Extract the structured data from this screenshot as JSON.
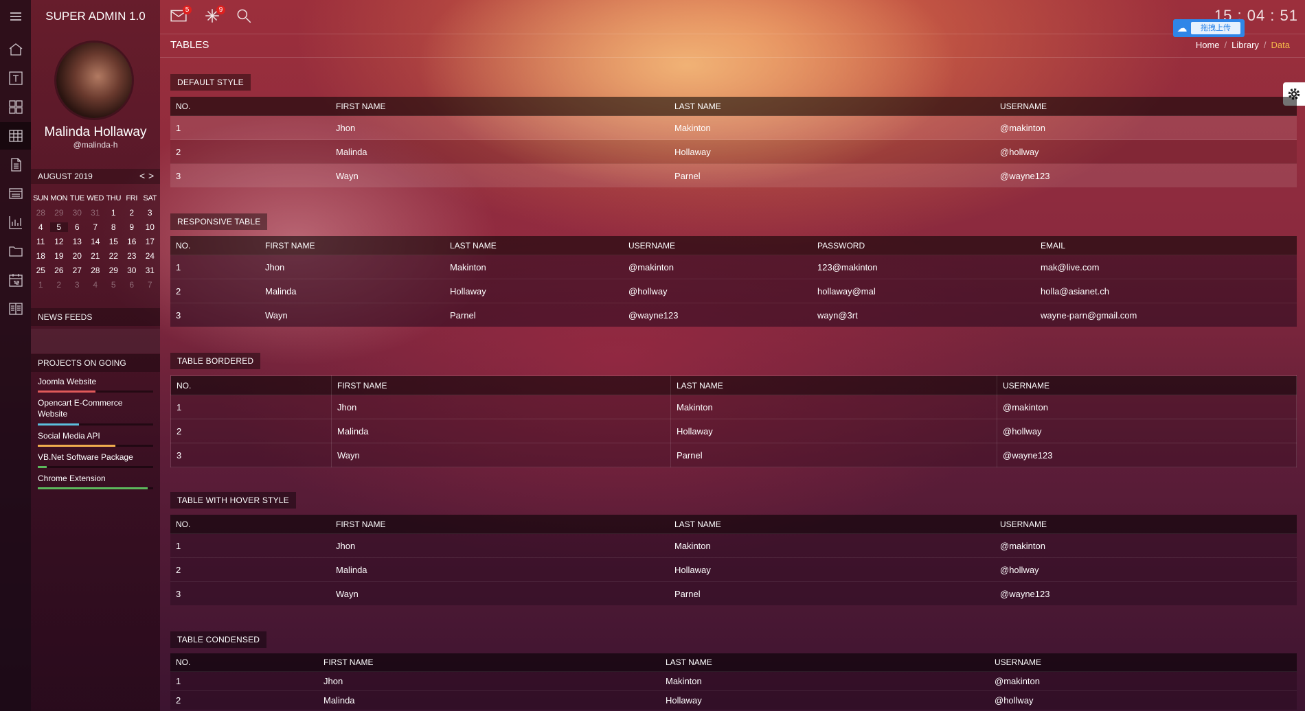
{
  "app": {
    "title": "SUPER ADMIN 1.0"
  },
  "topbar": {
    "mail_badge": "5",
    "notify_badge": "9",
    "clock": "15 : 04 : 51",
    "upload_label": "拖拽上传"
  },
  "page": {
    "title": "TABLES",
    "breadcrumb": [
      "Home",
      "Library",
      "Data"
    ]
  },
  "profile": {
    "name": "Malinda Hollaway",
    "handle": "@malinda-h"
  },
  "calendar": {
    "month": "AUGUST 2019",
    "prev": "<",
    "next": ">",
    "weekdays": [
      "SUN",
      "MON",
      "TUE",
      "WED",
      "THU",
      "FRI",
      "SAT"
    ],
    "weeks": [
      [
        "28",
        "29",
        "30",
        "31",
        "1",
        "2",
        "3"
      ],
      [
        "4",
        "5",
        "6",
        "7",
        "8",
        "9",
        "10"
      ],
      [
        "11",
        "12",
        "13",
        "14",
        "15",
        "16",
        "17"
      ],
      [
        "18",
        "19",
        "20",
        "21",
        "22",
        "23",
        "24"
      ],
      [
        "25",
        "26",
        "27",
        "28",
        "29",
        "30",
        "31"
      ],
      [
        "1",
        "2",
        "3",
        "4",
        "5",
        "6",
        "7"
      ]
    ]
  },
  "news": {
    "title": "NEWS FEEDS"
  },
  "projects": {
    "title": "PROJECTS ON GOING",
    "items": [
      {
        "name": "Joomla Website",
        "progress": 0.5,
        "color": "#e05a5a"
      },
      {
        "name": "Opencart E-Commerce Website",
        "progress": 0.36,
        "color": "#5bc0de"
      },
      {
        "name": "Social Media API",
        "progress": 0.67,
        "color": "#f0ad4e"
      },
      {
        "name": "VB.Net Software Package",
        "progress": 0.08,
        "color": "#5cb85c"
      },
      {
        "name": "Chrome Extension",
        "progress": 0.95,
        "color": "#5cb85c"
      }
    ]
  },
  "tables": {
    "default": {
      "label": "DEFAULT STYLE",
      "headers": [
        "NO.",
        "FIRST NAME",
        "LAST NAME",
        "USERNAME"
      ],
      "rows": [
        [
          "1",
          "Jhon",
          "Makinton",
          "@makinton"
        ],
        [
          "2",
          "Malinda",
          "Hollaway",
          "@hollway"
        ],
        [
          "3",
          "Wayn",
          "Parnel",
          "@wayne123"
        ]
      ]
    },
    "responsive": {
      "label": "RESPONSIVE TABLE",
      "headers": [
        "NO.",
        "FIRST NAME",
        "LAST NAME",
        "USERNAME",
        "PASSWORD",
        "EMAIL"
      ],
      "rows": [
        [
          "1",
          "Jhon",
          "Makinton",
          "@makinton",
          "123@makinton",
          "mak@live.com"
        ],
        [
          "2",
          "Malinda",
          "Hollaway",
          "@hollway",
          "hollaway@mal",
          "holla@asianet.ch"
        ],
        [
          "3",
          "Wayn",
          "Parnel",
          "@wayne123",
          "wayn@3rt",
          "wayne-parn@gmail.com"
        ]
      ]
    },
    "bordered": {
      "label": "TABLE BORDERED",
      "headers": [
        "NO.",
        "FIRST NAME",
        "LAST NAME",
        "USERNAME"
      ],
      "rows": [
        [
          "1",
          "Jhon",
          "Makinton",
          "@makinton"
        ],
        [
          "2",
          "Malinda",
          "Hollaway",
          "@hollway"
        ],
        [
          "3",
          "Wayn",
          "Parnel",
          "@wayne123"
        ]
      ]
    },
    "hover": {
      "label": "TABLE WITH HOVER STYLE",
      "headers": [
        "NO.",
        "FIRST NAME",
        "LAST NAME",
        "USERNAME"
      ],
      "rows": [
        [
          "1",
          "Jhon",
          "Makinton",
          "@makinton"
        ],
        [
          "2",
          "Malinda",
          "Hollaway",
          "@hollway"
        ],
        [
          "3",
          "Wayn",
          "Parnel",
          "@wayne123"
        ]
      ]
    },
    "condensed": {
      "label": "TABLE CONDENSED",
      "headers": [
        "NO.",
        "FIRST NAME",
        "LAST NAME",
        "USERNAME"
      ],
      "rows": [
        [
          "1",
          "Jhon",
          "Makinton",
          "@makinton"
        ],
        [
          "2",
          "Malinda",
          "Hollaway",
          "@hollway"
        ]
      ]
    }
  }
}
